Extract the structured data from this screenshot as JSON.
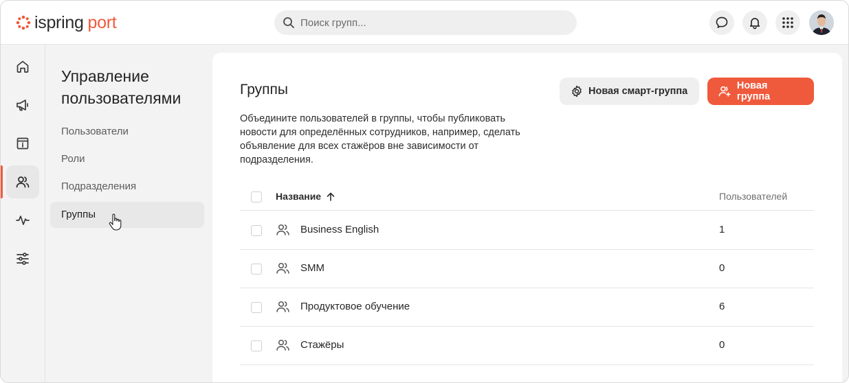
{
  "header": {
    "logo_primary": "ispring",
    "logo_secondary": "port",
    "search_placeholder": "Поиск групп...",
    "brand_color": "#f05a3c",
    "icons": [
      "chat-icon",
      "bell-icon",
      "apps-grid-icon",
      "user-avatar"
    ]
  },
  "rail": {
    "items": [
      {
        "name": "home-icon",
        "active": false
      },
      {
        "name": "megaphone-icon",
        "active": false
      },
      {
        "name": "info-board-icon",
        "active": false
      },
      {
        "name": "users-icon",
        "active": true
      },
      {
        "name": "activity-icon",
        "active": false
      },
      {
        "name": "settings-sliders-icon",
        "active": false
      }
    ]
  },
  "subnav": {
    "title": "Управление пользователями",
    "items": [
      {
        "label": "Пользователи",
        "active": false
      },
      {
        "label": "Роли",
        "active": false
      },
      {
        "label": "Подразделения",
        "active": false
      },
      {
        "label": "Группы",
        "active": true
      }
    ]
  },
  "main": {
    "title": "Группы",
    "description": "Объедините пользователей в группы, чтобы публиковать новости для определённых сотрудников, например, сделать объявление для всех стажёров вне зависимости от подразделения.",
    "smart_group_button": "Новая смарт-группа",
    "new_group_button": "Новая группа",
    "table": {
      "columns": {
        "name": "Название",
        "users": "Пользователей"
      },
      "sort": "name-ascending",
      "rows": [
        {
          "name": "Business English",
          "users": "1"
        },
        {
          "name": "SMM",
          "users": "0"
        },
        {
          "name": "Продуктовое обучение",
          "users": "6"
        },
        {
          "name": "Стажёры",
          "users": "0"
        }
      ]
    }
  }
}
